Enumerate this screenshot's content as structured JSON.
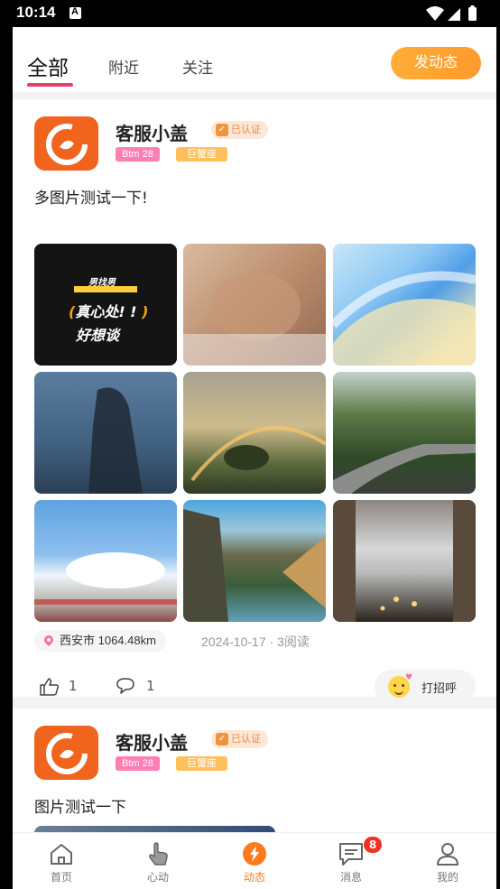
{
  "status_bar": {
    "time": "10:14",
    "notification_letter": "A"
  },
  "top_tabs": {
    "items": [
      {
        "label": "全部",
        "active": true
      },
      {
        "label": "附近",
        "active": false
      },
      {
        "label": "关注",
        "active": false
      }
    ],
    "post_button": "发动态",
    "accent": "#e83e69"
  },
  "posts": [
    {
      "username": "客服小盖",
      "verified_label": "已认证",
      "level_badge": "Btm 28",
      "zodiac_badge": "巨蟹座",
      "text": "多图片测试一下!",
      "photo1": {
        "line1": "男找男",
        "line2_open": "(",
        "line2_text": "真心处! ! ",
        "line2_close": ")",
        "line3": "好想谈"
      },
      "location": "西安市 1064.48km",
      "date_reads": "2024-10-17 · 3阅读",
      "likes": "1",
      "comments": "1",
      "greet_label": "打招呼"
    },
    {
      "username": "客服小盖",
      "verified_label": "已认证",
      "level_badge": "Btm 28",
      "zodiac_badge": "巨蟹座",
      "text": "图片测试一下"
    }
  ],
  "bottom_nav": {
    "items": [
      {
        "label": "首页",
        "icon": "home-icon",
        "active": false
      },
      {
        "label": "心动",
        "icon": "tap-hand-icon",
        "active": false
      },
      {
        "label": "动态",
        "icon": "lightning-icon",
        "active": true
      },
      {
        "label": "消息",
        "icon": "message-icon",
        "active": false,
        "badge": "8"
      },
      {
        "label": "我的",
        "icon": "person-icon",
        "active": false
      }
    ],
    "active_color": "#ff7a1d",
    "badge_color": "#ee3228"
  }
}
